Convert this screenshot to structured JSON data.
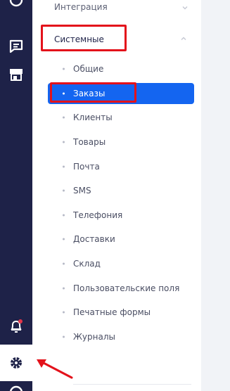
{
  "nav": {
    "group_title": "Интеграция",
    "section_title": "Системные",
    "items": [
      {
        "label": "Общие"
      },
      {
        "label": "Заказы",
        "active": true
      },
      {
        "label": "Клиенты"
      },
      {
        "label": "Товары"
      },
      {
        "label": "Почта"
      },
      {
        "label": "SMS"
      },
      {
        "label": "Телефония"
      },
      {
        "label": "Доставки"
      },
      {
        "label": "Склад"
      },
      {
        "label": "Пользовательские поля"
      },
      {
        "label": "Печатные формы"
      },
      {
        "label": "Журналы"
      }
    ]
  },
  "rail": {
    "icons": [
      "clock-icon",
      "chat-icon",
      "store-icon",
      "bell-icon",
      "gear-icon",
      "partial-icon"
    ],
    "notification_dot_color": "#e3354a"
  },
  "colors": {
    "rail_bg": "#1e2248",
    "accent": "#1465f0",
    "highlight": "#e3121b"
  }
}
